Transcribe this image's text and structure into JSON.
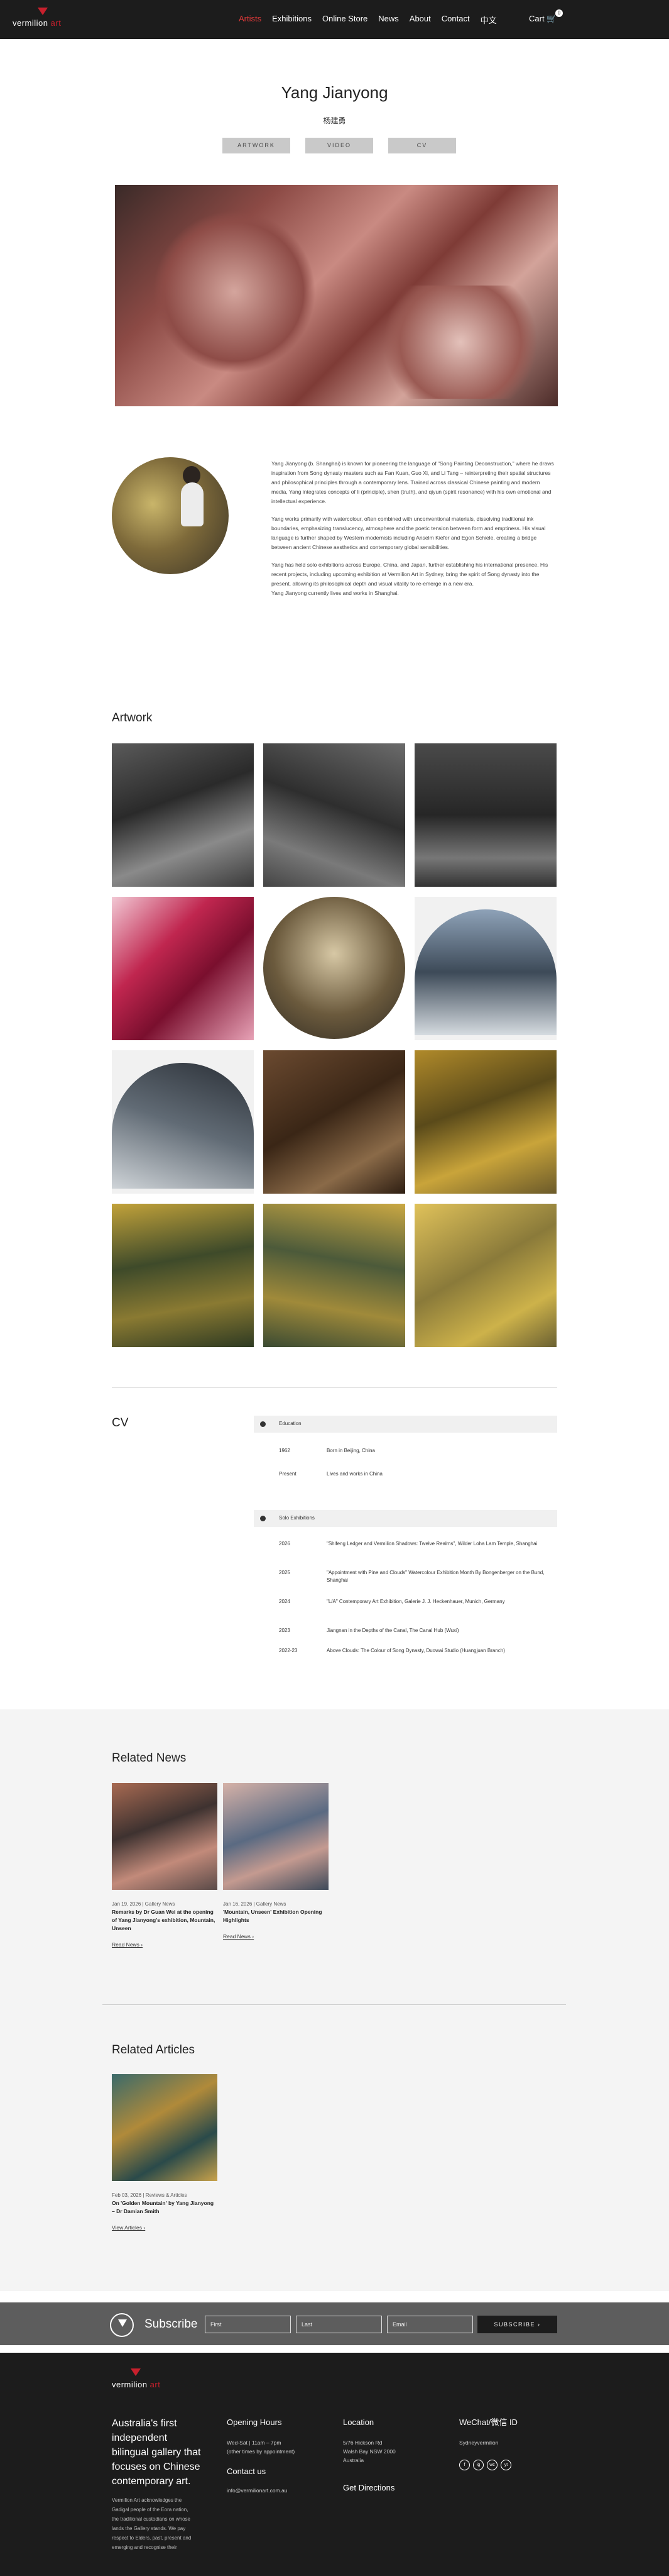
{
  "nav": {
    "logo_text_left": "vermilion",
    "logo_text_right": "art",
    "links": [
      "Artists",
      "Exhibitions",
      "Online Store",
      "News",
      "About",
      "Contact",
      "中文"
    ],
    "active": "Artists",
    "cart_label": "Cart",
    "cart_count": "0"
  },
  "artist": {
    "name": "Yang Jianyong",
    "name_cn": "杨建勇",
    "tabs": [
      "ARTWORK",
      "VIDEO",
      "CV"
    ]
  },
  "bio": [
    "Yang Jianyong (b. Shanghai) is known for pioneering the language of \"Song Painting Deconstruction,\" where he draws inspiration from Song dynasty masters such as Fan Kuan, Guo Xi, and Li Tang – reinterpreting their spatial structures and philosophical principles through a contemporary lens. Trained across classical Chinese painting and modern media, Yang integrates concepts of li (principle), shen (truth), and qiyun (spirit resonance) with his own emotional and intellectual experience.",
    "Yang works primarily with watercolour, often combined with unconventional materials, dissolving traditional ink boundaries, emphasizing translucency, atmosphere and the poetic tension between form and emptiness. His visual language is further shaped by Western modernists including Anselm Kiefer and Egon Schiele, creating a bridge between ancient Chinese aesthetics and contemporary global sensibilities.",
    "Yang has held solo exhibitions across Europe, China, and Japan, further establishing his international presence. His recent projects, including upcoming exhibition at Vermilion Art in Sydney, bring the spirit of Song dynasty into the present, allowing its philosophical depth and visual vitality to re-emerge in a new era.",
    "Yang Jianyong currently lives and works in Shanghai."
  ],
  "artwork": {
    "title": "Artwork"
  },
  "cv": {
    "title": "CV",
    "education_label": "Education",
    "education": [
      {
        "year": "1962",
        "text": "Born in Beijing, China"
      },
      {
        "year": "Present",
        "text": "Lives and works in China"
      }
    ],
    "solo_label": "Solo Exhibitions",
    "solo": [
      {
        "year": "2026",
        "text": "\"Shifeng Ledger and Vermilion Shadows: Twelve Realms\", Wilder Loha Lam Temple, Shanghai"
      },
      {
        "year": "2025",
        "text": "\"Appointment with Pine and Clouds\" Watercolour Exhibition Month By Bongenberger on the Bund, Shanghai"
      },
      {
        "year": "2024",
        "text": "\"L/A\" Contemporary Art Exhibition, Galerie J. J. Heckenhauer, Munich, Germany"
      },
      {
        "year": "2023",
        "text": "Jiangnan in the Depths of the Canal, The Canal Hub (Wuxi)"
      },
      {
        "year": "2022-23",
        "text": "Above Clouds: The Colour of Song Dynasty, Duowai Studio (Huangjuan Branch)"
      }
    ]
  },
  "related_news": {
    "title": "Related News",
    "items": [
      {
        "meta": "Jan 19, 2026 | Gallery News",
        "title": "Remarks by Dr Guan Wei at the opening of Yang Jianyong's exhibition, Mountain, Unseen",
        "more": "Read News ›"
      },
      {
        "meta": "Jan 16, 2026 | Gallery News",
        "title": "'Mountain, Unseen' Exhibition Opening Highlights",
        "more": "Read News ›"
      }
    ]
  },
  "related_articles": {
    "title": "Related Articles",
    "items": [
      {
        "meta": "Feb 03, 2026 | Reviews & Articles",
        "title": "On 'Golden Mountain' by Yang Jianyong – Dr Damian Smith",
        "more": "View Articles ›"
      }
    ]
  },
  "subscribe": {
    "title": "Subscribe",
    "first_placeholder": "First",
    "last_placeholder": "Last",
    "email_placeholder": "Email",
    "button": "SUBSCRIBE ›"
  },
  "footer": {
    "logo_text_left": "vermilion",
    "logo_text_right": "art",
    "tagline": "Australia's first independent bilingual gallery that focuses on Chinese contemporary art.",
    "acknowledgement": "Vermilion Art acknowledges the Gadigal people of the Eora nation, the traditional custodians on whose lands the Gallery stands. We pay respect to Elders, past, present and emerging and recognise their",
    "hours_title": "Opening Hours",
    "hours": [
      "Wed-Sat | 11am – 7pm",
      "(other times by appointment)"
    ],
    "contact_title": "Contact us",
    "contact_email": "info@vermilionart.com.au",
    "location_title": "Location",
    "location": [
      "5/76 Hickson Rd",
      "Walsh Bay NSW 2000",
      "Australia"
    ],
    "directions": "Get Directions",
    "wechat_title": "WeChat/微信 ID",
    "wechat_id": "Sydneyvermilion",
    "social": [
      "f",
      "ig",
      "wc",
      "yt"
    ]
  }
}
